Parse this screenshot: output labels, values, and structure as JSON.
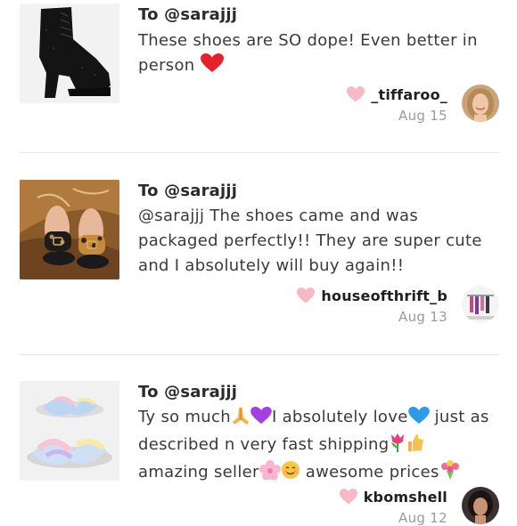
{
  "reviews": [
    {
      "to": "To @sarajjj",
      "comment_parts": [
        "These shoes are SO dope! Even better in person"
      ],
      "emojis": [
        "red-heart"
      ],
      "username": "_tiffaroo_",
      "date": "Aug 15",
      "product": "black lace-up platform heel bootie"
    },
    {
      "to": "To @sarajjj",
      "comment_parts": [
        "@sarajjj The shoes came and was packaged perfectly!! They are super cute and I absolutely will buy again!!"
      ],
      "emojis": [],
      "username": "houseofthrift_b",
      "date": "Aug 13",
      "product": "leopard print buckle slide sandals"
    },
    {
      "to": "To @sarajjj",
      "comment_parts": [
        "Ty so much",
        "I absolutely love",
        " just as described n very fast shipping",
        "",
        "amazing seller",
        "",
        " awesome prices"
      ],
      "emojis": [
        "folded-hands",
        "purple-heart",
        "blue-heart",
        "tulip",
        "thumbs-up",
        "cherry-blossom",
        "smiling-face",
        "bouquet"
      ],
      "username": "kbomshell",
      "date": "Aug 12",
      "product": "tie-dye fuzzy crisscross slippers"
    }
  ],
  "colors": {
    "heart_like": "#f7b9c3",
    "date": "#9a9a9a",
    "divider": "#e4e4e4"
  }
}
